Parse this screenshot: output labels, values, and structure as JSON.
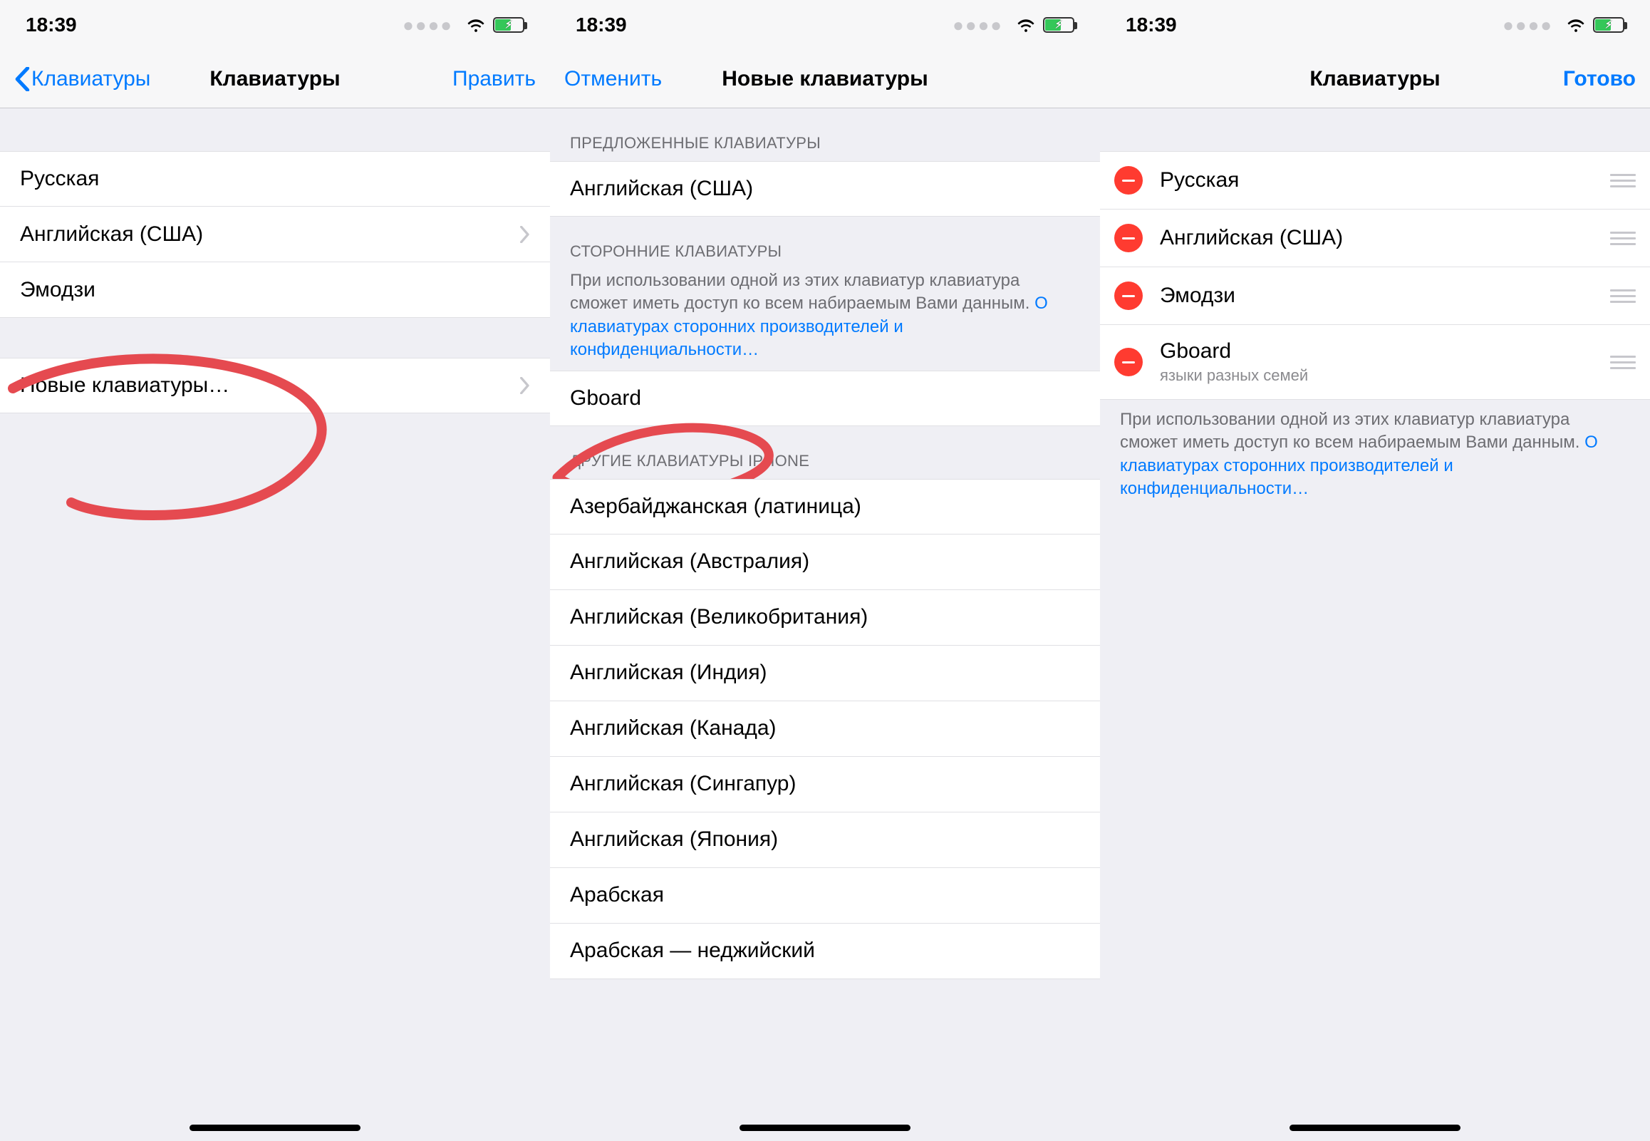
{
  "status": {
    "time": "18:39"
  },
  "screen1": {
    "nav": {
      "back": "Клавиатуры",
      "title": "Клавиатуры",
      "right": "Править"
    },
    "rows": [
      "Русская",
      "Английская (США)",
      "Эмодзи"
    ],
    "new_row": "Новые клавиатуры…"
  },
  "screen2": {
    "nav": {
      "left": "Отменить",
      "title": "Новые клавиатуры"
    },
    "section1_header": "ПРЕДЛОЖЕННЫЕ КЛАВИАТУРЫ",
    "section1_rows": [
      "Английская (США)"
    ],
    "section2_header": "СТОРОННИЕ КЛАВИАТУРЫ",
    "section2_footer_text": "При использовании одной из этих клавиатур клавиатура сможет иметь доступ ко всем набираемым Вами данным. ",
    "section2_footer_link": "О клавиатурах сторонних производителей и конфиденциальности…",
    "section2_rows": [
      "Gboard"
    ],
    "section3_header": "ДРУГИЕ КЛАВИАТУРЫ IPHONE",
    "section3_rows": [
      "Азербайджанская (латиница)",
      "Английская (Австралия)",
      "Английская (Великобритания)",
      "Английская (Индия)",
      "Английская (Канада)",
      "Английская (Сингапур)",
      "Английская (Япония)",
      "Арабская",
      "Арабская — неджийский"
    ]
  },
  "screen3": {
    "nav": {
      "title": "Клавиатуры",
      "right": "Готово"
    },
    "rows": [
      {
        "label": "Русская"
      },
      {
        "label": "Английская (США)"
      },
      {
        "label": "Эмодзи"
      },
      {
        "label": "Gboard",
        "sub": "языки разных семей"
      }
    ],
    "footer_text": "При использовании одной из этих клавиатур клавиатура сможет иметь доступ ко всем набираемым Вами данным. ",
    "footer_link": "О клавиатурах сторонних производителей и конфиденциальности…"
  }
}
